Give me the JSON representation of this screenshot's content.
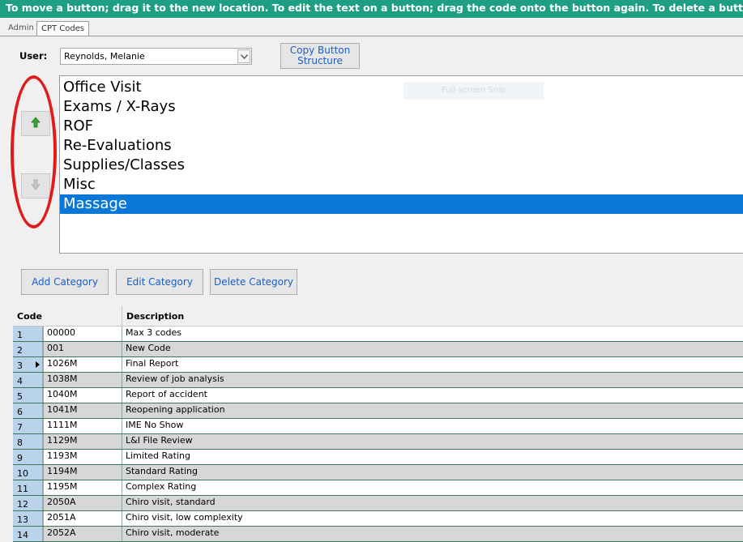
{
  "banner": {
    "text": "To move a button; drag it to the new location. To edit the text on a button; drag the code onto the button again.  To delete a button; ri"
  },
  "tabs": [
    {
      "label": "Admin"
    },
    {
      "label": "CPT Codes"
    }
  ],
  "user": {
    "label": "User:",
    "value": "Reynolds, Melanie"
  },
  "buttons": {
    "copy_line1": "Copy Button",
    "copy_line2": "Structure",
    "add_category": "Add Category",
    "edit_category": "Edit Category",
    "delete_category": "Delete Category"
  },
  "categories": [
    "Office Visit",
    "Exams / X-Rays",
    "ROF",
    "Re-Evaluations",
    "Supplies/Classes",
    "Misc",
    "Massage"
  ],
  "selected_category": "Massage",
  "snip_label": "Full-screen Snip",
  "grid": {
    "headers": {
      "code": "Code",
      "description": "Description"
    },
    "rows": [
      {
        "num": "1",
        "code": "00000",
        "desc": "Max 3 codes"
      },
      {
        "num": "2",
        "code": "001",
        "desc": "New Code"
      },
      {
        "num": "3",
        "code": "1026M",
        "desc": "Final Report"
      },
      {
        "num": "4",
        "code": "1038M",
        "desc": "Review of job analysis"
      },
      {
        "num": "5",
        "code": "1040M",
        "desc": "Report of accident"
      },
      {
        "num": "6",
        "code": "1041M",
        "desc": "Reopening application"
      },
      {
        "num": "7",
        "code": "1111M",
        "desc": "IME No Show"
      },
      {
        "num": "8",
        "code": "1129M",
        "desc": "L&I File Review"
      },
      {
        "num": "9",
        "code": "1193M",
        "desc": "Limited Rating"
      },
      {
        "num": "10",
        "code": "1194M",
        "desc": "Standard Rating"
      },
      {
        "num": "11",
        "code": "1195M",
        "desc": "Complex Rating"
      },
      {
        "num": "12",
        "code": "2050A",
        "desc": "Chiro visit, standard"
      },
      {
        "num": "13",
        "code": "2051A",
        "desc": "Chiro visit, low complexity"
      },
      {
        "num": "14",
        "code": "2052A",
        "desc": "Chiro visit, moderate"
      }
    ],
    "current_row": "3"
  },
  "colors": {
    "banner": "#1e9e82",
    "selection": "#0b78d7",
    "annotation": "#e11b1b",
    "up_arrow": "#3aa335"
  }
}
